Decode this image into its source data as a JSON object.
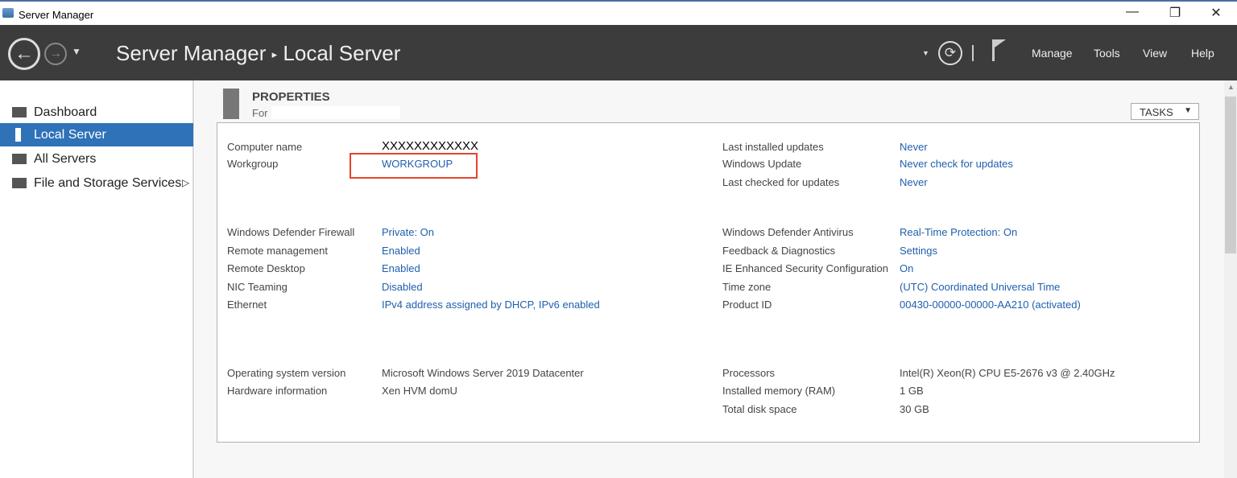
{
  "window": {
    "title": "Server Manager",
    "minimize": "—",
    "restore": "❐",
    "close": "✕"
  },
  "header": {
    "app": "Server Manager",
    "separator": "▸",
    "page": "Local Server",
    "menu": [
      "Manage",
      "Tools",
      "View",
      "Help"
    ]
  },
  "sidebar": {
    "items": [
      {
        "label": "Dashboard"
      },
      {
        "label": "Local Server",
        "active": true
      },
      {
        "label": "All Servers"
      },
      {
        "label": "File and Storage Services",
        "arrow": "▷"
      }
    ]
  },
  "properties": {
    "title": "PROPERTIES",
    "for": "For",
    "tasks": "TASKS",
    "left": [
      {
        "label": "Computer name",
        "value": "XXXXXXXXXXXX"
      },
      {
        "label": "Workgroup",
        "value": "WORKGROUP"
      },
      {
        "label": "Windows Defender Firewall",
        "value": "Private: On"
      },
      {
        "label": "Remote management",
        "value": "Enabled"
      },
      {
        "label": "Remote Desktop",
        "value": "Enabled"
      },
      {
        "label": "NIC Teaming",
        "value": "Disabled"
      },
      {
        "label": "Ethernet",
        "value": "IPv4 address assigned by DHCP, IPv6 enabled"
      },
      {
        "label": "Operating system version",
        "value": "Microsoft Windows Server 2019 Datacenter"
      },
      {
        "label": "Hardware information",
        "value": "Xen HVM domU"
      }
    ],
    "right": [
      {
        "label": "Last installed updates",
        "value": "Never"
      },
      {
        "label": "Windows Update",
        "value": "Never check for updates"
      },
      {
        "label": "Last checked for updates",
        "value": "Never"
      },
      {
        "label": "Windows Defender Antivirus",
        "value": "Real-Time Protection: On"
      },
      {
        "label": "Feedback & Diagnostics",
        "value": "Settings"
      },
      {
        "label": "IE Enhanced Security Configuration",
        "value": "On"
      },
      {
        "label": "Time zone",
        "value": "(UTC) Coordinated Universal Time"
      },
      {
        "label": "Product ID",
        "value": "00430-00000-00000-AA210 (activated)"
      },
      {
        "label": "Processors",
        "value": "Intel(R) Xeon(R) CPU E5-2676 v3 @ 2.40GHz"
      },
      {
        "label": "Installed memory (RAM)",
        "value": "1 GB"
      },
      {
        "label": "Total disk space",
        "value": "30 GB"
      }
    ]
  },
  "colors": {
    "accent": "#2f72b8",
    "link": "#1f5fae",
    "header": "#3c3c3c",
    "highlight": "#e8432e"
  }
}
